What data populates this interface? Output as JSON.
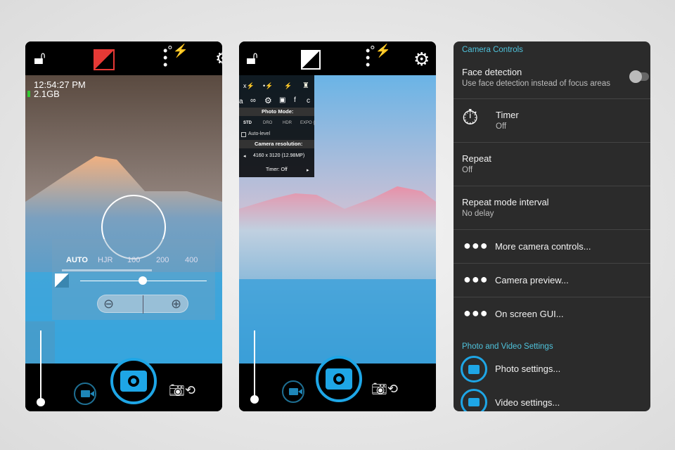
{
  "screen1": {
    "icons": [
      "lock-open-icon",
      "exposure-icon",
      "flash-menu-icon",
      "settings-icon"
    ],
    "time": "12:54:27 PM",
    "storage": "2.1GB",
    "iso_options": [
      "AUTO",
      "HJR",
      "100",
      "200",
      "400"
    ],
    "exposure_level": 0.5,
    "accent": "#e53935"
  },
  "screen2": {
    "menu_icons_row1": [
      "x⚡",
      "•⚡",
      "⚡",
      "torch"
    ],
    "menu_icons_row2": [
      "a",
      "∞",
      "⚙",
      "🔒",
      "f",
      "c"
    ],
    "photo_mode_label": "Photo Mode:",
    "modes": [
      "STD",
      "DRO",
      "HDR",
      "EXPO {}"
    ],
    "auto_level": "Auto-level",
    "resolution_label": "Camera resolution:",
    "resolution": "4160 x 3120 (12.98MP)",
    "timer": "Timer: Off"
  },
  "settings": {
    "section1": "Camera Controls",
    "face_title": "Face detection",
    "face_sub": "Use face detection instead of focus areas",
    "face_enabled": false,
    "timer_title": "Timer",
    "timer_sub": "Off",
    "repeat_title": "Repeat",
    "repeat_sub": "Off",
    "interval_title": "Repeat mode interval",
    "interval_sub": "No delay",
    "more": "More camera controls...",
    "preview": "Camera preview...",
    "gui": "On screen GUI...",
    "section2": "Photo and Video Settings",
    "photo": "Photo settings...",
    "video": "Video settings..."
  },
  "accent": "#1ea6e6"
}
